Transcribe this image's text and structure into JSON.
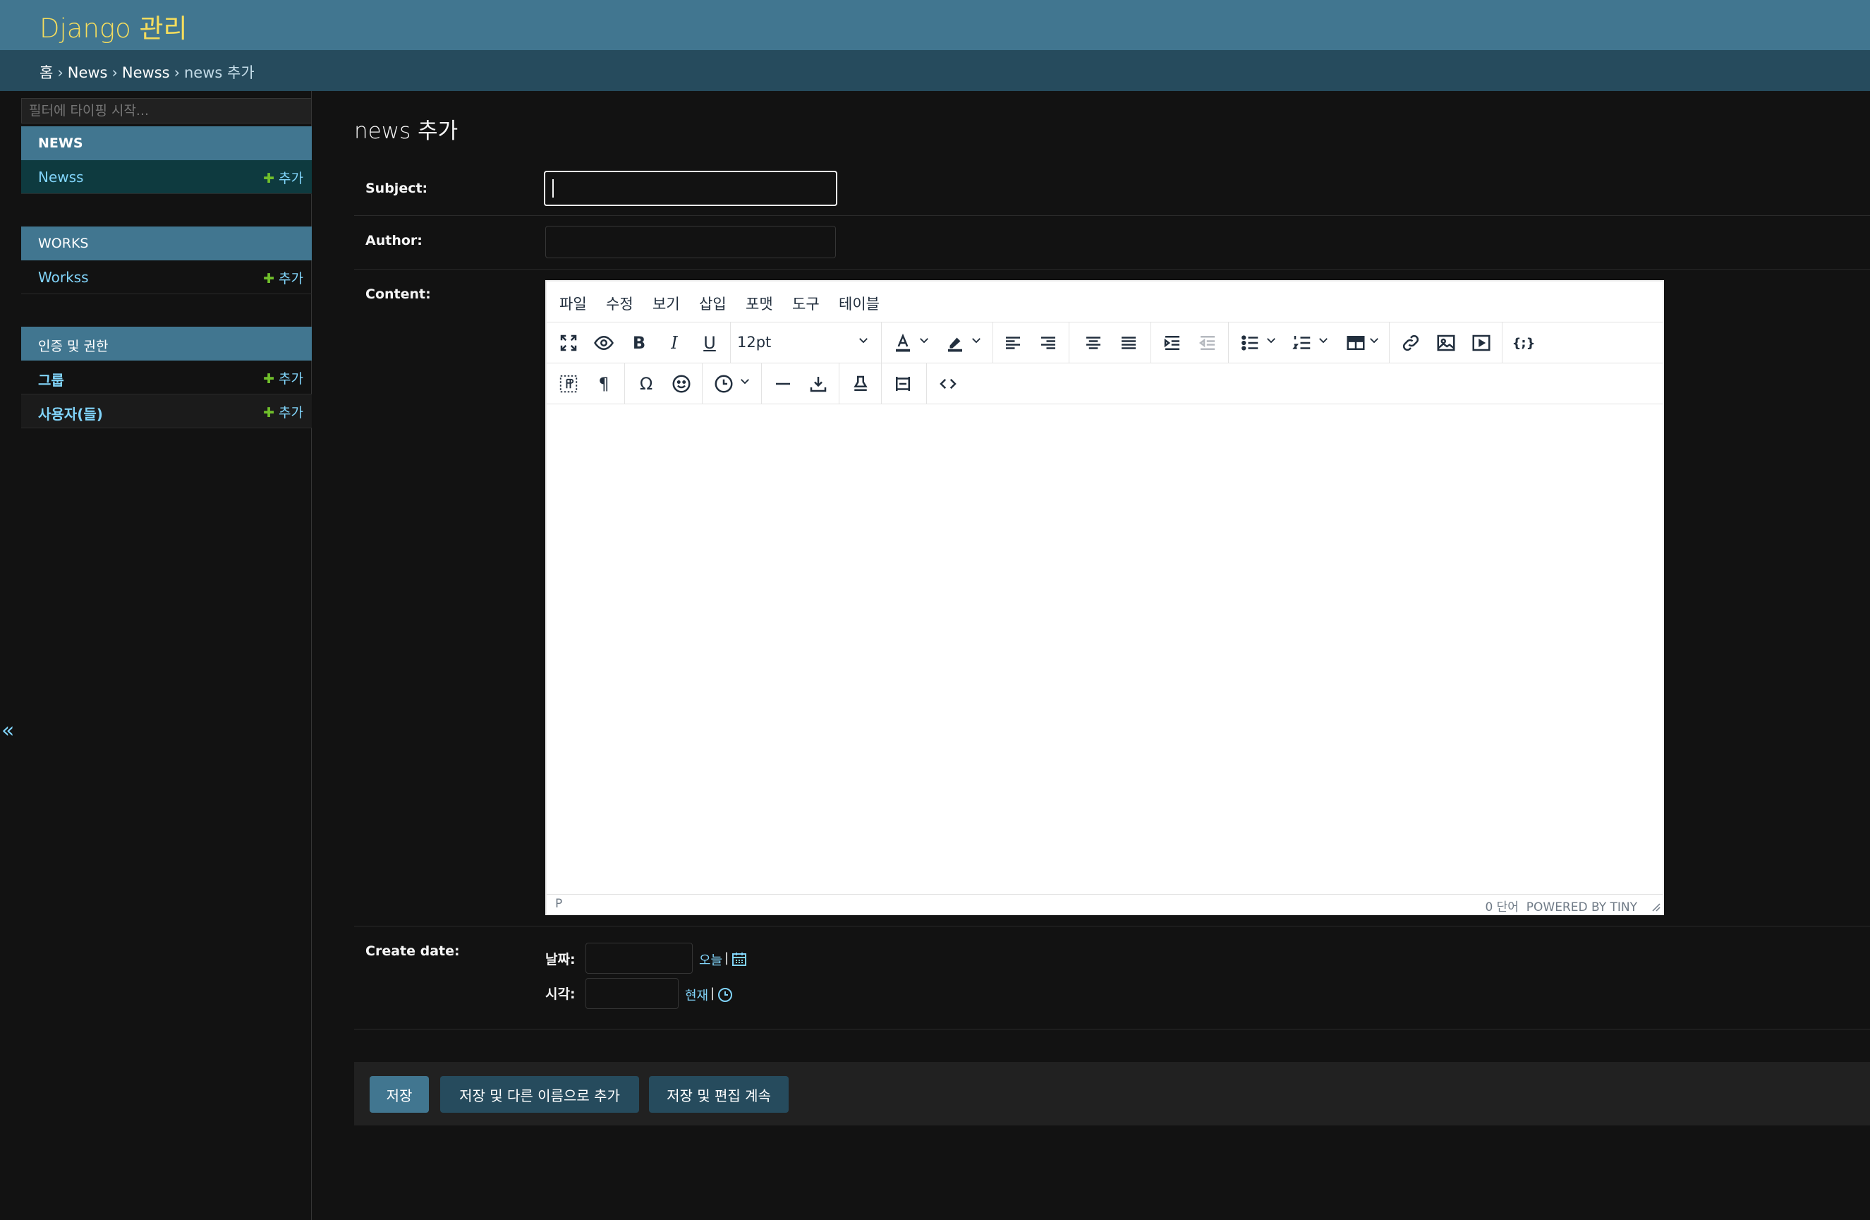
{
  "header": {
    "site_title": "Django 관리"
  },
  "breadcrumbs": {
    "home": "홈",
    "app": "News",
    "model": "Newss",
    "current": "news 추가",
    "separator": "›"
  },
  "sidebar": {
    "filter_placeholder": "필터에 타이핑 시작...",
    "modules": [
      {
        "caption": "NEWS",
        "models": [
          {
            "name": "Newss",
            "add": "추가"
          }
        ]
      },
      {
        "caption": "WORKS",
        "models": [
          {
            "name": "Workss",
            "add": "추가"
          }
        ]
      },
      {
        "caption": "인증 및 권한",
        "models": [
          {
            "name": "그룹",
            "add": "추가"
          },
          {
            "name": "사용자(들)",
            "add": "추가"
          }
        ]
      }
    ],
    "collapse_glyph": "«"
  },
  "content": {
    "title": "news 추가",
    "fields": {
      "subject": {
        "label": "Subject:",
        "value": ""
      },
      "author": {
        "label": "Author:",
        "value": ""
      },
      "content": {
        "label": "Content:"
      },
      "create_date": {
        "label": "Create date:"
      }
    }
  },
  "editor": {
    "menu": [
      "파일",
      "수정",
      "보기",
      "삽입",
      "포맷",
      "도구",
      "테이블"
    ],
    "font_size": "12pt",
    "status_path": "P",
    "word_count": "0 단어",
    "powered_by": "POWERED BY TINY",
    "icon_colors": {
      "fg": "#222f3e"
    }
  },
  "datetime": {
    "date_label": "날짜:",
    "today_link": "오늘",
    "time_label": "시각:",
    "now_link": "현재",
    "separator": "|"
  },
  "submit": {
    "save": "저장",
    "save_add_another": "저장 및 다른 이름으로 추가",
    "save_continue": "저장 및 편집 계속"
  },
  "colors": {
    "header_bg": "#417690",
    "breadcrumb_bg": "#264b5d",
    "accent_yellow": "#f5dd5d",
    "link_blue": "#81d4fa",
    "add_green": "#70bf2b"
  }
}
